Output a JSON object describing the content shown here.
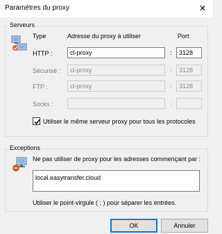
{
  "window": {
    "title": "Paramètres du proxy",
    "close_glyph": "✕"
  },
  "servers": {
    "legend": "Serveurs",
    "col_type": "Type",
    "col_address": "Adresse du proxy à utiliser",
    "col_port": "Port",
    "rows": [
      {
        "label": "HTTP :",
        "address": "cl-proxy",
        "port": "3128",
        "enabled": true
      },
      {
        "label": "Sécurisé :",
        "address": "cl-proxy",
        "port": "3128",
        "enabled": false
      },
      {
        "label": "FTP :",
        "address": "cl-proxy",
        "port": "3128",
        "enabled": false
      },
      {
        "label": "Socks :",
        "address": "",
        "port": "",
        "enabled": false
      }
    ],
    "colon": ":",
    "same_server_checkbox": {
      "label": "Utiliser le même serveur proxy pour tous les protocoles",
      "checked": true
    }
  },
  "exceptions": {
    "legend": "Exceptions",
    "prompt": "Ne pas utiliser de proxy pour les adresses commençant par :",
    "value": "local.easytransfer.cloud",
    "hint": "Utiliser le point-virgule ( ; ) pour séparer les entrées."
  },
  "buttons": {
    "ok": "OK",
    "cancel": "Annuler"
  },
  "icons": {
    "servers": "network-computers-icon",
    "exceptions": "computer-exceptions-icon",
    "close": "close-icon",
    "check": "checkmark-icon"
  }
}
